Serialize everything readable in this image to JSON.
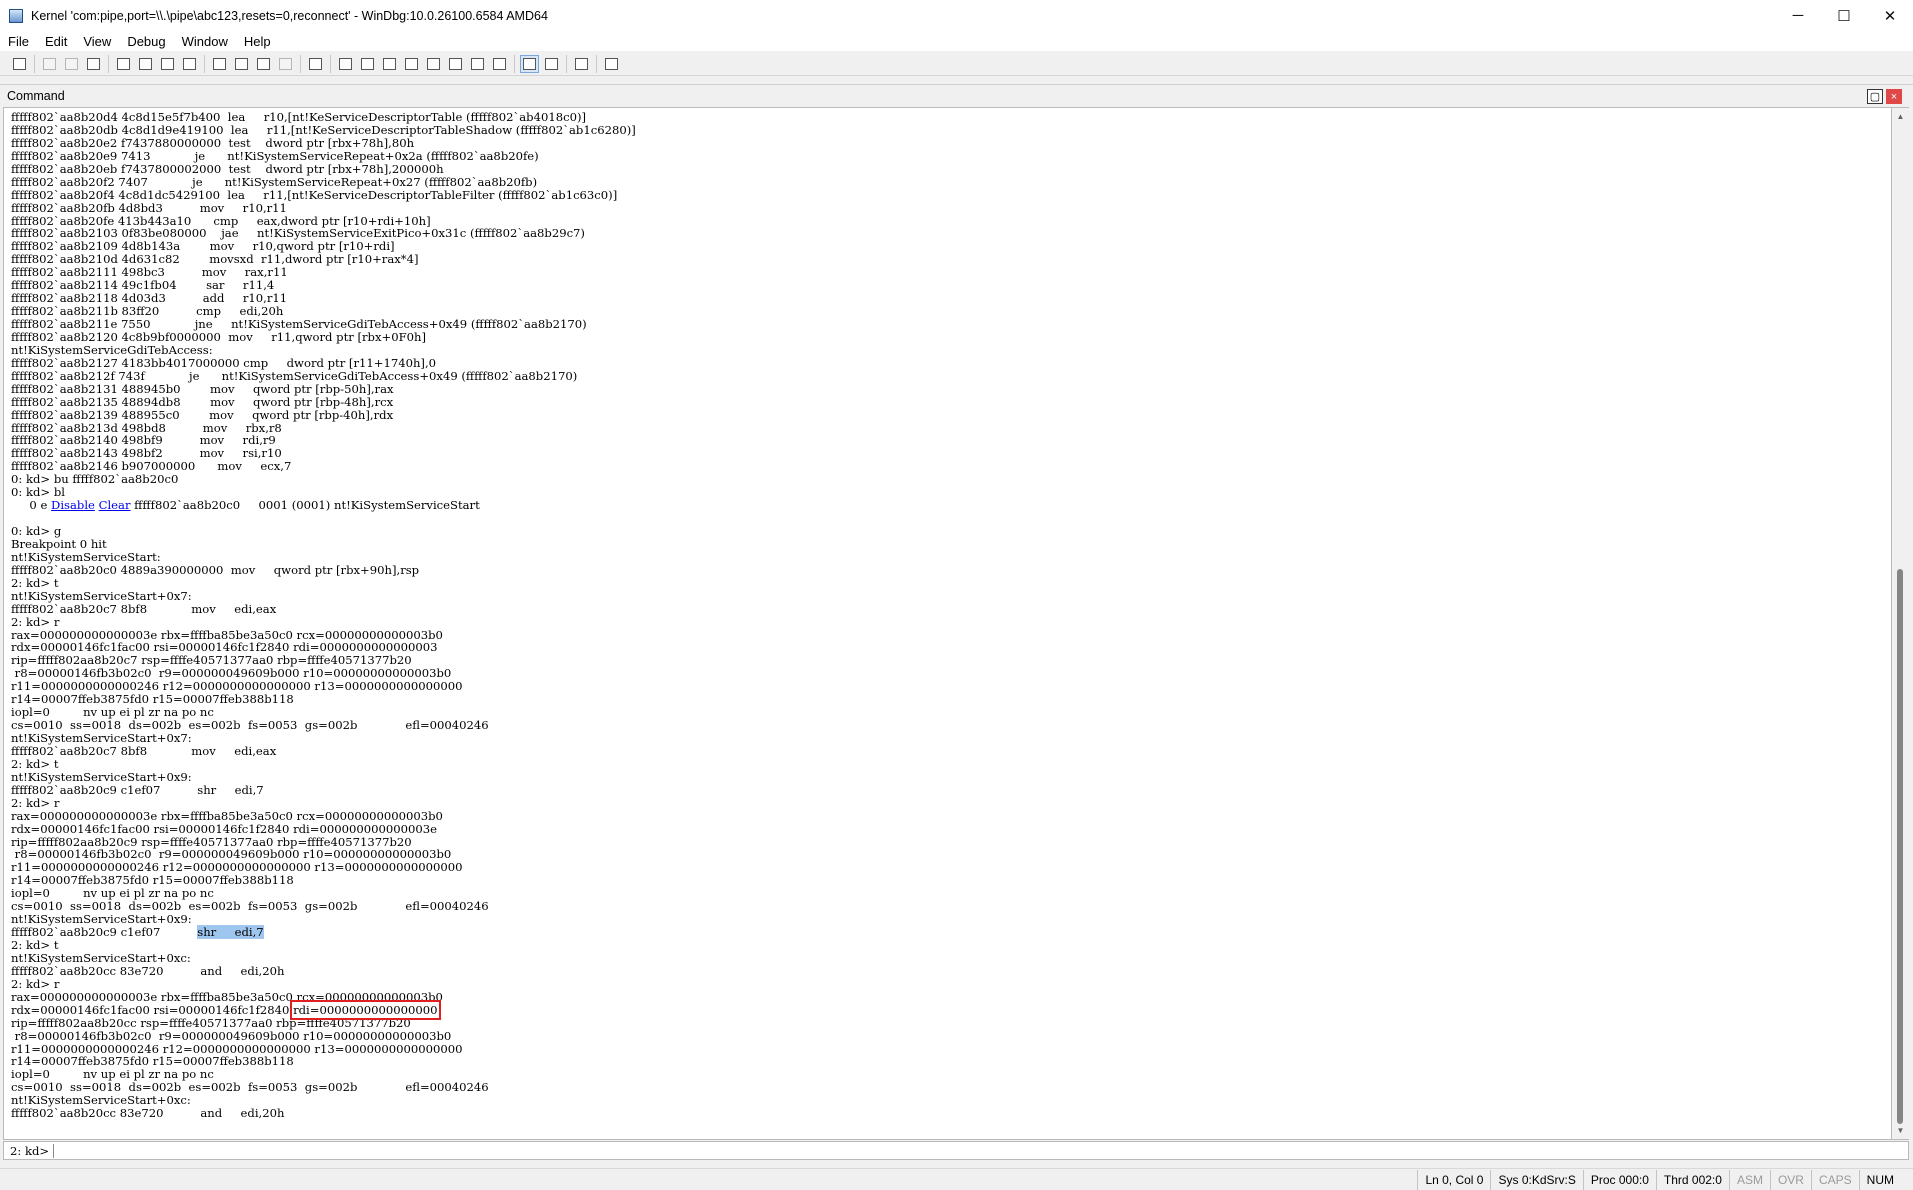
{
  "window": {
    "title": "Kernel 'com:pipe,port=\\\\.\\pipe\\abc123,resets=0,reconnect' - WinDbg:10.0.26100.6584 AMD64",
    "minimize_glyph": "─",
    "maximize_glyph": "☐",
    "close_glyph": "✕"
  },
  "menu": {
    "items": [
      "File",
      "Edit",
      "View",
      "Debug",
      "Window",
      "Help"
    ]
  },
  "toolbar": {
    "buttons": [
      {
        "icon": "open-icon",
        "state": "normal"
      },
      {
        "icon": "cut-icon",
        "state": "disabled"
      },
      {
        "icon": "copy-icon",
        "state": "disabled"
      },
      {
        "icon": "paste-icon",
        "state": "normal"
      },
      {
        "icon": "go-icon",
        "state": "normal"
      },
      {
        "icon": "restart-icon",
        "state": "normal"
      },
      {
        "icon": "stop-debugging-icon",
        "state": "normal"
      },
      {
        "icon": "detach-icon",
        "state": "normal"
      },
      {
        "icon": "step-into-icon",
        "state": "normal"
      },
      {
        "icon": "step-over-icon",
        "state": "normal"
      },
      {
        "icon": "step-out-icon",
        "state": "normal"
      },
      {
        "icon": "run-to-cursor-icon",
        "state": "disabled"
      },
      {
        "icon": "break-icon",
        "state": "normal"
      },
      {
        "icon": "command-window-icon",
        "state": "normal"
      },
      {
        "icon": "watch-window-icon",
        "state": "normal"
      },
      {
        "icon": "locals-window-icon",
        "state": "normal"
      },
      {
        "icon": "registers-window-icon",
        "state": "normal"
      },
      {
        "icon": "memory-window-icon",
        "state": "normal"
      },
      {
        "icon": "call-stack-window-icon",
        "state": "normal"
      },
      {
        "icon": "disassembly-window-icon",
        "state": "normal"
      },
      {
        "icon": "scratch-pad-icon",
        "state": "normal"
      },
      {
        "icon": "source-mode-icon",
        "state": "active"
      },
      {
        "icon": "binary-mode-icon",
        "state": "normal"
      },
      {
        "icon": "font-icon",
        "state": "normal"
      },
      {
        "icon": "options-icon",
        "state": "normal"
      }
    ]
  },
  "command_pane": {
    "title": "Command",
    "float_glyph": "▢",
    "close_glyph": "×"
  },
  "output": {
    "link_disable": "Disable",
    "link_clear": "Clear",
    "lines": [
      "fffff802`aa8b20d4 4c8d15e5f7b400  lea     r10,[nt!KeServiceDescriptorTable (fffff802`ab4018c0)]",
      "fffff802`aa8b20db 4c8d1d9e419100  lea     r11,[nt!KeServiceDescriptorTableShadow (fffff802`ab1c6280)]",
      "fffff802`aa8b20e2 f7437880000000  test    dword ptr [rbx+78h],80h",
      "fffff802`aa8b20e9 7413            je      nt!KiSystemServiceRepeat+0x2a (fffff802`aa8b20fe)",
      "fffff802`aa8b20eb f7437800002000  test    dword ptr [rbx+78h],200000h",
      "fffff802`aa8b20f2 7407            je      nt!KiSystemServiceRepeat+0x27 (fffff802`aa8b20fb)",
      "fffff802`aa8b20f4 4c8d1dc5429100  lea     r11,[nt!KeServiceDescriptorTableFilter (fffff802`ab1c63c0)]",
      "fffff802`aa8b20fb 4d8bd3          mov     r10,r11",
      "fffff802`aa8b20fe 413b443a10      cmp     eax,dword ptr [r10+rdi+10h]",
      "fffff802`aa8b2103 0f83be080000    jae     nt!KiSystemServiceExitPico+0x31c (fffff802`aa8b29c7)",
      "fffff802`aa8b2109 4d8b143a        mov     r10,qword ptr [r10+rdi]",
      "fffff802`aa8b210d 4d631c82        movsxd  r11,dword ptr [r10+rax*4]",
      "fffff802`aa8b2111 498bc3          mov     rax,r11",
      "fffff802`aa8b2114 49c1fb04        sar     r11,4",
      "fffff802`aa8b2118 4d03d3          add     r10,r11",
      "fffff802`aa8b211b 83ff20          cmp     edi,20h",
      "fffff802`aa8b211e 7550            jne     nt!KiSystemServiceGdiTebAccess+0x49 (fffff802`aa8b2170)",
      "fffff802`aa8b2120 4c8b9bf0000000  mov     r11,qword ptr [rbx+0F0h]",
      "nt!KiSystemServiceGdiTebAccess:",
      "fffff802`aa8b2127 4183bb4017000000 cmp     dword ptr [r11+1740h],0",
      "fffff802`aa8b212f 743f            je      nt!KiSystemServiceGdiTebAccess+0x49 (fffff802`aa8b2170)",
      "fffff802`aa8b2131 488945b0        mov     qword ptr [rbp-50h],rax",
      "fffff802`aa8b2135 48894db8        mov     qword ptr [rbp-48h],rcx",
      "fffff802`aa8b2139 488955c0        mov     qword ptr [rbp-40h],rdx",
      "fffff802`aa8b213d 498bd8          mov     rbx,r8",
      "fffff802`aa8b2140 498bf9          mov     rdi,r9",
      "fffff802`aa8b2143 498bf2          mov     rsi,r10",
      "fffff802`aa8b2146 b907000000      mov     ecx,7",
      "0: kd> bu fffff802`aa8b20c0",
      "0: kd> bl",
      "     0 e ",
      " fffff802`aa8b20c0     0001 (0001) nt!KiSystemServiceStart",
      "",
      "0: kd> g",
      "Breakpoint 0 hit",
      "nt!KiSystemServiceStart:",
      "fffff802`aa8b20c0 4889a390000000  mov     qword ptr [rbx+90h],rsp",
      "2: kd> t",
      "nt!KiSystemServiceStart+0x7:",
      "fffff802`aa8b20c7 8bf8            mov     edi,eax",
      "2: kd> r",
      "rax=000000000000003e rbx=ffffba85be3a50c0 rcx=00000000000003b0",
      "rdx=00000146fc1fac00 rsi=00000146fc1f2840 rdi=0000000000000003",
      "rip=fffff802aa8b20c7 rsp=ffffe40571377aa0 rbp=ffffe40571377b20",
      " r8=00000146fb3b02c0  r9=000000049609b000 r10=00000000000003b0",
      "r11=0000000000000246 r12=0000000000000000 r13=0000000000000000",
      "r14=00007ffeb3875fd0 r15=00007ffeb388b118",
      "iopl=0         nv up ei pl zr na po nc",
      "cs=0010  ss=0018  ds=002b  es=002b  fs=0053  gs=002b             efl=00040246",
      "nt!KiSystemServiceStart+0x7:",
      "fffff802`aa8b20c7 8bf8            mov     edi,eax",
      "2: kd> t",
      "nt!KiSystemServiceStart+0x9:",
      "fffff802`aa8b20c9 c1ef07          shr     edi,7",
      "2: kd> r",
      "rax=000000000000003e rbx=ffffba85be3a50c0 rcx=00000000000003b0",
      "rdx=00000146fc1fac00 rsi=00000146fc1f2840 rdi=000000000000003e",
      "rip=fffff802aa8b20c9 rsp=ffffe40571377aa0 rbp=ffffe40571377b20",
      " r8=00000146fb3b02c0  r9=000000049609b000 r10=00000000000003b0",
      "r11=0000000000000246 r12=0000000000000000 r13=0000000000000000",
      "r14=00007ffeb3875fd0 r15=00007ffeb388b118",
      "iopl=0         nv up ei pl zr na po nc",
      "cs=0010  ss=0018  ds=002b  es=002b  fs=0053  gs=002b             efl=00040246",
      "nt!KiSystemServiceStart+0x9:",
      "fffff802`aa8b20c9 c1ef07          ",
      "shr     edi,7",
      "2: kd> t",
      "nt!KiSystemServiceStart+0xc:",
      "fffff802`aa8b20cc 83e720          and     edi,20h",
      "2: kd> r",
      "rax=000000000000003e rbx=ffffba85be3a50c0 rcx=00000000000003b0",
      "rdx=00000146fc1fac00 rsi=00000146fc1f2840 ",
      "rdi=0000000000000000",
      "rip=fffff802aa8b20cc rsp=ffffe40571377aa0 rbp=ffffe40571377b20",
      " r8=00000146fb3b02c0  r9=000000049609b000 r10=00000000000003b0",
      "r11=0000000000000246 r12=0000000000000000 r13=0000000000000000",
      "r14=00007ffeb3875fd0 r15=00007ffeb388b118",
      "iopl=0         nv up ei pl zr na po nc",
      "cs=0010  ss=0018  ds=002b  es=002b  fs=0053  gs=002b             efl=00040246",
      "nt!KiSystemServiceStart+0xc:",
      "fffff802`aa8b20cc 83e720          and     edi,20h"
    ]
  },
  "command_input": {
    "prompt": "2: kd>",
    "value": ""
  },
  "status": {
    "items": [
      "Ln 0, Col 0",
      "Sys 0:KdSrv:S",
      "Proc 000:0",
      "Thrd 002:0",
      "ASM",
      "OVR",
      "CAPS",
      "NUM"
    ],
    "dim": [
      false,
      false,
      false,
      false,
      true,
      true,
      true,
      false
    ]
  },
  "colors": {
    "link": "#0000ee",
    "selection": "#9ec6ef",
    "highlight_box": "#e02020"
  },
  "scrollbar": {
    "position_fraction": 0.44
  }
}
